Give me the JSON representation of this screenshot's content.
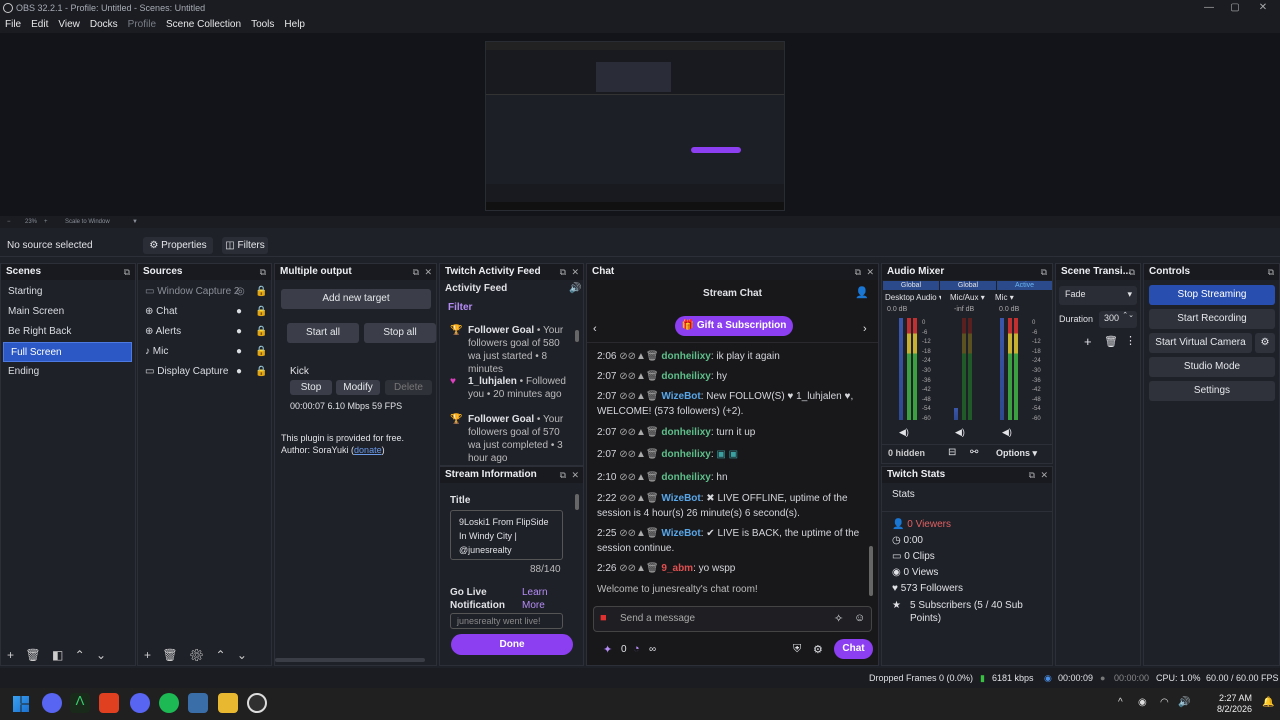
{
  "title": "OBS 32.2.1 - Profile: Untitled - Scenes: Untitled",
  "menu": [
    "File",
    "Edit",
    "View",
    "Docks",
    "Profile",
    "Scene Collection",
    "Tools",
    "Help"
  ],
  "zoom": {
    "percent": "23%",
    "mode": "Scale to Window"
  },
  "source_bar": {
    "status": "No source selected",
    "properties": "Properties",
    "filters": "Filters"
  },
  "scenes": {
    "title": "Scenes",
    "items": [
      "Starting",
      "Main Screen",
      "Be Right Back",
      "Full Screen",
      "Ending"
    ],
    "selected": "Full Screen"
  },
  "sources": {
    "title": "Sources",
    "items": [
      "Window Capture 2",
      "Chat",
      "Alerts",
      "Mic",
      "Display Capture"
    ]
  },
  "multi": {
    "title": "Multiple output",
    "add": "Add new target",
    "start_all": "Start all",
    "stop_all": "Stop all",
    "target": "Kick",
    "stop": "Stop",
    "modify": "Modify",
    "delete": "Delete",
    "stats": "00:00:07  6.10 Mbps  59 FPS",
    "free": "This plugin is provided for free.",
    "author": "Author: SoraYuki (",
    "donate": "donate",
    "author_end": ")"
  },
  "activity": {
    "title": "Twitch Activity Feed",
    "heading": "Activity Feed",
    "filter": "Filter",
    "items": [
      {
        "text_a": "Follower Goal",
        "text_b": " • Your followers goal of 580 wa just started • 8 minutes"
      },
      {
        "text_a": "1_luhjalen",
        "text_b": " • Followed you • 20 minutes ago"
      },
      {
        "text_a": "Follower Goal",
        "text_b": " • Your followers goal of 570 wa just completed • 3 hour ago"
      }
    ]
  },
  "streaminfo": {
    "title": "Stream Information",
    "label_title": "Title",
    "value": "9Loski1 From FlipSide In Windy City | @junesrealty",
    "count": "88/140",
    "golive": "Go Live Notification",
    "learn": "Learn More",
    "notif_placeholder": "junesrealty went live!",
    "done": "Done"
  },
  "chat": {
    "title": "Chat",
    "heading": "Stream Chat",
    "gift": "Gift a Subscription",
    "welcome": "Welcome to junesrealty's chat room!",
    "placeholder": "Send a message",
    "points": "0",
    "chat_btn": "Chat",
    "infinity": "∞",
    "lines": [
      {
        "time": "2:06",
        "user": "donheilixy",
        "msg": ": ik play it again",
        "cls": "g"
      },
      {
        "time": "2:07",
        "user": "donheilixy",
        "msg": ": hy",
        "cls": "g"
      },
      {
        "time": "2:07",
        "user": "WizeBot",
        "msg": ": New FOLLOW(S) ♥ 1_luhjalen ♥, WELCOME! (573 followers) (+2).",
        "cls": "b"
      },
      {
        "time": "2:07",
        "user": "donheilixy",
        "msg": ": turn it up",
        "cls": "g"
      },
      {
        "time": "2:07",
        "user": "donheilixy",
        "msg": ":",
        "cls": "g"
      },
      {
        "time": "2:10",
        "user": "donheilixy",
        "msg": ": hn",
        "cls": "g"
      },
      {
        "time": "2:22",
        "user": "WizeBot",
        "msg": ": ✖ LIVE OFFLINE, uptime of the session is 4 hour(s) 26 minute(s) 6 second(s).",
        "cls": "b"
      },
      {
        "time": "2:25",
        "user": "WizeBot",
        "msg": ": ✔ LIVE is BACK, the uptime of the session continue.",
        "cls": "b"
      },
      {
        "time": "2:26",
        "user": "9_abm",
        "msg": ": yo wspp",
        "cls": "r"
      }
    ]
  },
  "mixer": {
    "title": "Audio Mixer",
    "channels": [
      {
        "scope": "Global",
        "name": "Desktop Audio",
        "db": "0.0 dB"
      },
      {
        "scope": "Global",
        "name": "Mic/Aux",
        "db": "-inf dB"
      },
      {
        "scope": "Active",
        "name": "Mic",
        "db": "0.0 dB"
      }
    ],
    "scale": [
      "0",
      "-6",
      "-12",
      "-18",
      "-24",
      "-30",
      "-36",
      "-42",
      "-48",
      "-54",
      "-60"
    ],
    "hidden": "0 hidden",
    "options": "Options"
  },
  "transitions": {
    "title": "Scene Transi...",
    "type": "Fade",
    "duration_label": "Duration",
    "duration": "300"
  },
  "controls": {
    "title": "Controls",
    "buttons": [
      "Stop Streaming",
      "Start Recording",
      "Start Virtual Camera",
      "Studio Mode",
      "Settings"
    ]
  },
  "stats": {
    "title": "Twitch Stats",
    "heading": "Stats",
    "items": [
      "0 Viewers",
      "0:00",
      "0 Clips",
      "0 Views",
      "573 Followers",
      "5 Subscribers (5 / 40 Sub Points)"
    ]
  },
  "statusbar": {
    "dropped": "Dropped Frames 0 (0.0%)",
    "kbps": "6181 kbps",
    "stream_time": "00:00:09",
    "rec_time": "00:00:00",
    "cpu": "CPU: 1.0%",
    "fps": "60.00 / 60.00 FPS"
  },
  "taskbar": {
    "time": "2:27 AM",
    "date": "8/2/2026"
  },
  "colors": {
    "accent": "#8c3ff0",
    "selected": "#2b58c4",
    "bg": "#1f2129"
  }
}
